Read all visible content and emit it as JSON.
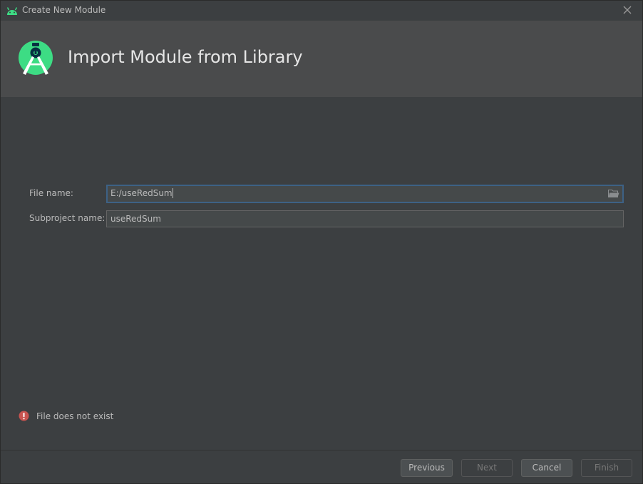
{
  "titlebar": {
    "title": "Create New Module",
    "app_icon": "android-icon",
    "close_icon": "close-icon"
  },
  "header": {
    "title": "Import Module from Library",
    "logo": "android-studio-logo"
  },
  "form": {
    "file_name": {
      "label": "File name:",
      "value": "E:/useRedSum",
      "browse_icon": "folder-icon"
    },
    "subproject_name": {
      "label": "Subproject name:",
      "value": "useRedSum"
    }
  },
  "error": {
    "icon": "error-icon",
    "color": "#c75450",
    "text": "File does not exist"
  },
  "buttons": {
    "previous": "Previous",
    "next": "Next",
    "cancel": "Cancel",
    "finish": "Finish"
  },
  "colors": {
    "android_green": "#3ddc84",
    "focus_border": "#3d6185",
    "background": "#3c3f41"
  }
}
